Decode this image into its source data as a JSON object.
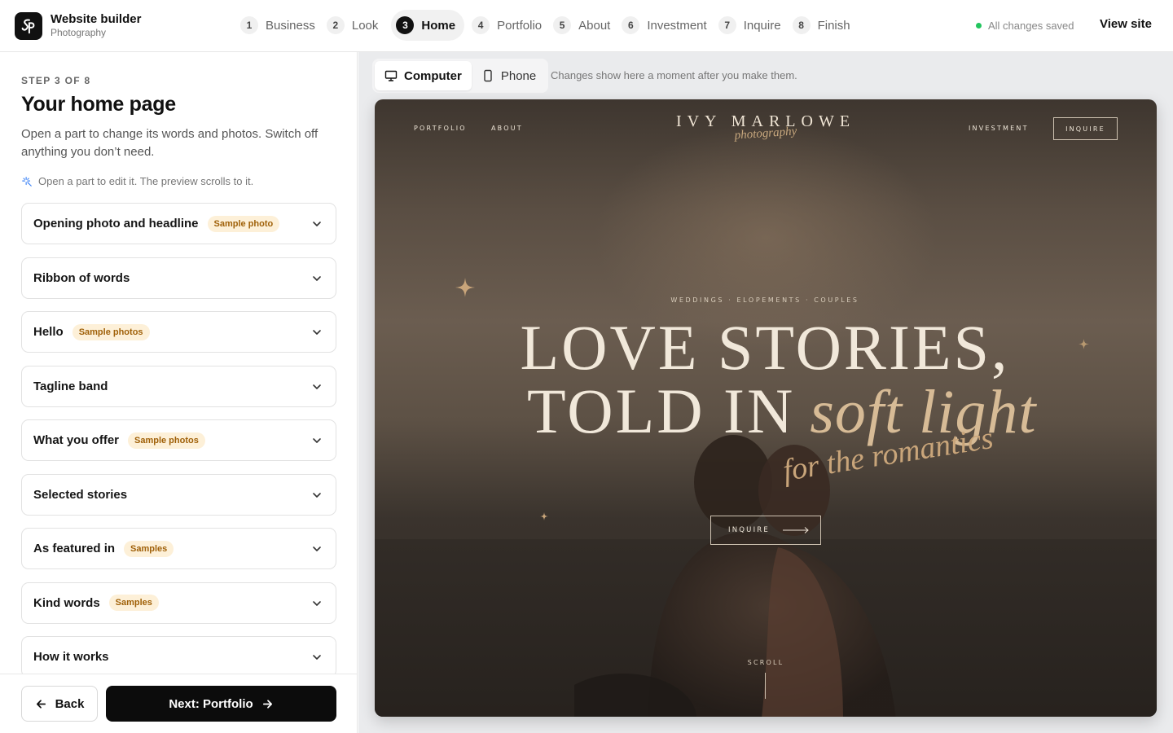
{
  "app": {
    "title": "Website builder",
    "subtitle": "Photography",
    "saved_status": "All changes saved",
    "view_site": "View site"
  },
  "steps": [
    {
      "num": "1",
      "label": "Business",
      "active": false
    },
    {
      "num": "2",
      "label": "Look",
      "active": false
    },
    {
      "num": "3",
      "label": "Home",
      "active": true
    },
    {
      "num": "4",
      "label": "Portfolio",
      "active": false
    },
    {
      "num": "5",
      "label": "About",
      "active": false
    },
    {
      "num": "6",
      "label": "Investment",
      "active": false
    },
    {
      "num": "7",
      "label": "Inquire",
      "active": false
    },
    {
      "num": "8",
      "label": "Finish",
      "active": false
    }
  ],
  "sidebar": {
    "step_count": "STEP 3 OF 8",
    "title": "Your home page",
    "description": "Open a part to change its words and photos. Switch off anything you don’t need.",
    "hint": "Open a part to edit it. The preview scrolls to it.",
    "sections": [
      {
        "title": "Opening photo and headline",
        "badge": "Sample photo"
      },
      {
        "title": "Ribbon of words",
        "badge": ""
      },
      {
        "title": "Hello",
        "badge": "Sample photos"
      },
      {
        "title": "Tagline band",
        "badge": ""
      },
      {
        "title": "What you offer",
        "badge": "Sample photos"
      },
      {
        "title": "Selected stories",
        "badge": ""
      },
      {
        "title": "As featured in",
        "badge": "Samples"
      },
      {
        "title": "Kind words",
        "badge": "Samples"
      },
      {
        "title": "How it works",
        "badge": ""
      }
    ],
    "back_label": "Back",
    "next_label": "Next: Portfolio"
  },
  "preview": {
    "devices": [
      {
        "label": "Computer",
        "icon": "monitor-icon",
        "active": true
      },
      {
        "label": "Phone",
        "icon": "phone-icon",
        "active": false
      }
    ],
    "note": "Changes show here a moment after you make them.",
    "site": {
      "nav_left": [
        "PORTFOLIO",
        "ABOUT"
      ],
      "brand": "IVY MARLOWE",
      "brand_sub": "photography",
      "nav_right": "INVESTMENT",
      "nav_inquire": "INQUIRE",
      "eyebrow": "WEDDINGS · ELOPEMENTS · COUPLES",
      "headline_line1": "LOVE STORIES,",
      "headline_line2": "TOLD IN",
      "headline_script": "soft light",
      "headline_script2": "for the romantics",
      "cta": "INQUIRE",
      "scroll": "SCROLL"
    }
  },
  "colors": {
    "accent": "#111111",
    "badge_bg": "#fdf0d8",
    "badge_text": "#a06109",
    "saved_dot": "#22c55e",
    "script_gold": "#d7bb96"
  }
}
